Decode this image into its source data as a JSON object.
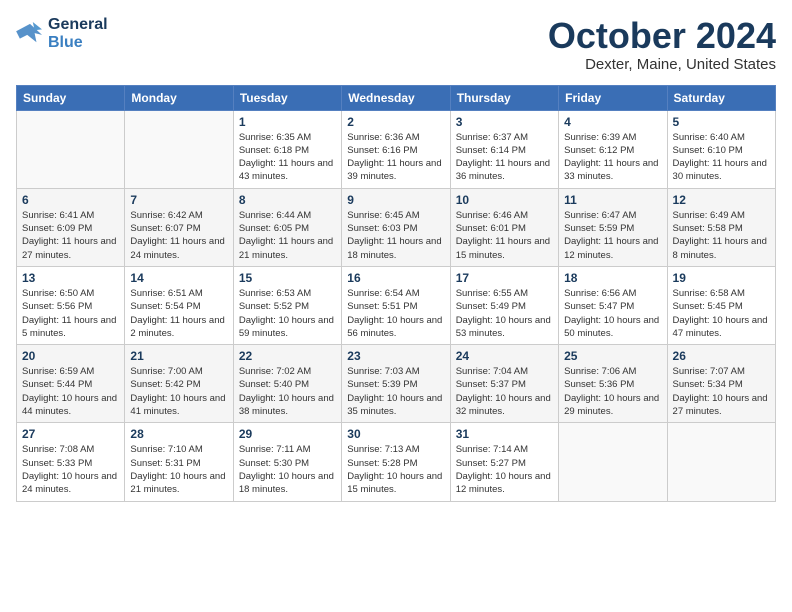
{
  "logo": {
    "line1": "General",
    "line2": "Blue"
  },
  "header": {
    "month": "October 2024",
    "location": "Dexter, Maine, United States"
  },
  "weekdays": [
    "Sunday",
    "Monday",
    "Tuesday",
    "Wednesday",
    "Thursday",
    "Friday",
    "Saturday"
  ],
  "weeks": [
    [
      {
        "day": "",
        "info": ""
      },
      {
        "day": "",
        "info": ""
      },
      {
        "day": "1",
        "info": "Sunrise: 6:35 AM\nSunset: 6:18 PM\nDaylight: 11 hours and 43 minutes."
      },
      {
        "day": "2",
        "info": "Sunrise: 6:36 AM\nSunset: 6:16 PM\nDaylight: 11 hours and 39 minutes."
      },
      {
        "day": "3",
        "info": "Sunrise: 6:37 AM\nSunset: 6:14 PM\nDaylight: 11 hours and 36 minutes."
      },
      {
        "day": "4",
        "info": "Sunrise: 6:39 AM\nSunset: 6:12 PM\nDaylight: 11 hours and 33 minutes."
      },
      {
        "day": "5",
        "info": "Sunrise: 6:40 AM\nSunset: 6:10 PM\nDaylight: 11 hours and 30 minutes."
      }
    ],
    [
      {
        "day": "6",
        "info": "Sunrise: 6:41 AM\nSunset: 6:09 PM\nDaylight: 11 hours and 27 minutes."
      },
      {
        "day": "7",
        "info": "Sunrise: 6:42 AM\nSunset: 6:07 PM\nDaylight: 11 hours and 24 minutes."
      },
      {
        "day": "8",
        "info": "Sunrise: 6:44 AM\nSunset: 6:05 PM\nDaylight: 11 hours and 21 minutes."
      },
      {
        "day": "9",
        "info": "Sunrise: 6:45 AM\nSunset: 6:03 PM\nDaylight: 11 hours and 18 minutes."
      },
      {
        "day": "10",
        "info": "Sunrise: 6:46 AM\nSunset: 6:01 PM\nDaylight: 11 hours and 15 minutes."
      },
      {
        "day": "11",
        "info": "Sunrise: 6:47 AM\nSunset: 5:59 PM\nDaylight: 11 hours and 12 minutes."
      },
      {
        "day": "12",
        "info": "Sunrise: 6:49 AM\nSunset: 5:58 PM\nDaylight: 11 hours and 8 minutes."
      }
    ],
    [
      {
        "day": "13",
        "info": "Sunrise: 6:50 AM\nSunset: 5:56 PM\nDaylight: 11 hours and 5 minutes."
      },
      {
        "day": "14",
        "info": "Sunrise: 6:51 AM\nSunset: 5:54 PM\nDaylight: 11 hours and 2 minutes."
      },
      {
        "day": "15",
        "info": "Sunrise: 6:53 AM\nSunset: 5:52 PM\nDaylight: 10 hours and 59 minutes."
      },
      {
        "day": "16",
        "info": "Sunrise: 6:54 AM\nSunset: 5:51 PM\nDaylight: 10 hours and 56 minutes."
      },
      {
        "day": "17",
        "info": "Sunrise: 6:55 AM\nSunset: 5:49 PM\nDaylight: 10 hours and 53 minutes."
      },
      {
        "day": "18",
        "info": "Sunrise: 6:56 AM\nSunset: 5:47 PM\nDaylight: 10 hours and 50 minutes."
      },
      {
        "day": "19",
        "info": "Sunrise: 6:58 AM\nSunset: 5:45 PM\nDaylight: 10 hours and 47 minutes."
      }
    ],
    [
      {
        "day": "20",
        "info": "Sunrise: 6:59 AM\nSunset: 5:44 PM\nDaylight: 10 hours and 44 minutes."
      },
      {
        "day": "21",
        "info": "Sunrise: 7:00 AM\nSunset: 5:42 PM\nDaylight: 10 hours and 41 minutes."
      },
      {
        "day": "22",
        "info": "Sunrise: 7:02 AM\nSunset: 5:40 PM\nDaylight: 10 hours and 38 minutes."
      },
      {
        "day": "23",
        "info": "Sunrise: 7:03 AM\nSunset: 5:39 PM\nDaylight: 10 hours and 35 minutes."
      },
      {
        "day": "24",
        "info": "Sunrise: 7:04 AM\nSunset: 5:37 PM\nDaylight: 10 hours and 32 minutes."
      },
      {
        "day": "25",
        "info": "Sunrise: 7:06 AM\nSunset: 5:36 PM\nDaylight: 10 hours and 29 minutes."
      },
      {
        "day": "26",
        "info": "Sunrise: 7:07 AM\nSunset: 5:34 PM\nDaylight: 10 hours and 27 minutes."
      }
    ],
    [
      {
        "day": "27",
        "info": "Sunrise: 7:08 AM\nSunset: 5:33 PM\nDaylight: 10 hours and 24 minutes."
      },
      {
        "day": "28",
        "info": "Sunrise: 7:10 AM\nSunset: 5:31 PM\nDaylight: 10 hours and 21 minutes."
      },
      {
        "day": "29",
        "info": "Sunrise: 7:11 AM\nSunset: 5:30 PM\nDaylight: 10 hours and 18 minutes."
      },
      {
        "day": "30",
        "info": "Sunrise: 7:13 AM\nSunset: 5:28 PM\nDaylight: 10 hours and 15 minutes."
      },
      {
        "day": "31",
        "info": "Sunrise: 7:14 AM\nSunset: 5:27 PM\nDaylight: 10 hours and 12 minutes."
      },
      {
        "day": "",
        "info": ""
      },
      {
        "day": "",
        "info": ""
      }
    ]
  ]
}
